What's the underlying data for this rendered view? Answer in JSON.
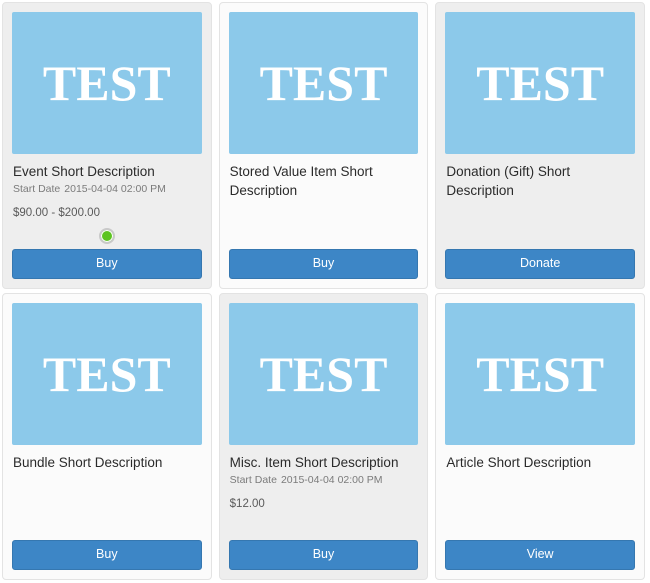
{
  "thumbnail": {
    "word": "TEST",
    "color": "#8cc9ea"
  },
  "theme": {
    "button_color": "#3d86c6",
    "card_gray": "#eeeeee",
    "card_light": "#fbfbfb",
    "status_green": "#5cc420"
  },
  "cards": [
    {
      "title": "Event Short Description",
      "meta_label": "Start Date",
      "meta_value": "2015-04-04 02:00 PM",
      "price": "$90.00 - $200.00",
      "status_dot": true,
      "button_label": "Buy",
      "thumb_word": "TEST"
    },
    {
      "title": "Stored Value Item Short Description",
      "meta_label": "",
      "meta_value": "",
      "price": "",
      "status_dot": false,
      "button_label": "Buy",
      "thumb_word": "TEST"
    },
    {
      "title": "Donation (Gift) Short Description",
      "meta_label": "",
      "meta_value": "",
      "price": "",
      "status_dot": false,
      "button_label": "Donate",
      "thumb_word": "TEST"
    },
    {
      "title": "Bundle Short Description",
      "meta_label": "",
      "meta_value": "",
      "price": "",
      "status_dot": false,
      "button_label": "Buy",
      "thumb_word": "TEST"
    },
    {
      "title": "Misc. Item Short Description",
      "meta_label": "Start Date",
      "meta_value": "2015-04-04 02:00 PM",
      "price": "$12.00",
      "status_dot": false,
      "button_label": "Buy",
      "thumb_word": "TEST"
    },
    {
      "title": "Article Short Description",
      "meta_label": "",
      "meta_value": "",
      "price": "",
      "status_dot": false,
      "button_label": "View",
      "thumb_word": "TEST"
    }
  ]
}
